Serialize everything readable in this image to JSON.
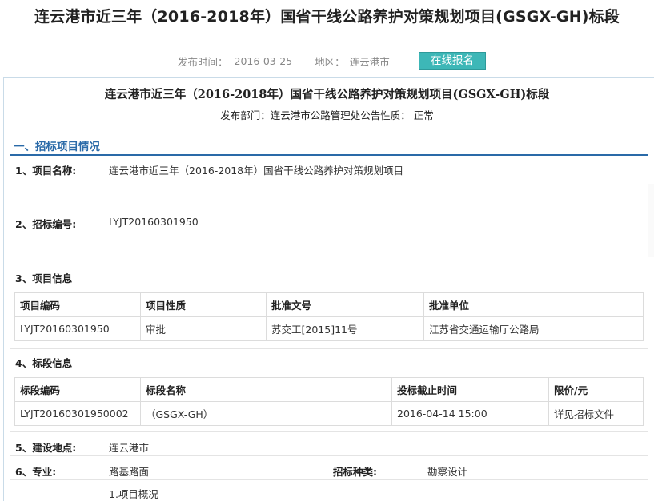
{
  "header": {
    "title": "连云港市近三年（2016-2018年）国省干线公路养护对策规划项目(GSGX-GH)标段",
    "publish_time_label": "发布时间：",
    "publish_time": "2016-03-25",
    "region_label": "地区：",
    "region": "连云港市",
    "signup_button": "在线报名"
  },
  "doc": {
    "title": "连云港市近三年（2016-2018年）国省干线公路养护对策规划项目(GSGX-GH)标段",
    "publisher_line": "发布部门：连云港市公路管理处公告性质：  正常"
  },
  "section1": {
    "heading": "一、招标项目情况",
    "item1_label": "1、项目名称:",
    "item1_value": "连云港市近三年（2016-2018年）国省干线公路养护对策规划项目",
    "item2_label": "2、招标编号:",
    "item2_value": "LYJT20160301950",
    "item3_label": "3、项目信息",
    "item4_label": "4、标段信息",
    "item5_label": "5、建设地点:",
    "item5_value": "连云港市",
    "item6_label": "6、专业:",
    "item6_value": "路基路面",
    "type_label": "招标种类:",
    "type_value": "勘察设计",
    "overview": "1.项目概况"
  },
  "project_table": {
    "headers": [
      "项目编码",
      "项目性质",
      "批准文号",
      "批准单位"
    ],
    "rows": [
      [
        "LYJT20160301950",
        "审批",
        "苏交工[2015]11号",
        "江苏省交通运输厅公路局"
      ]
    ]
  },
  "section_table": {
    "headers": [
      "标段编码",
      "标段名称",
      "投标截止时间",
      "限价/元"
    ],
    "rows": [
      [
        "LYJT20160301950002",
        "（GSGX-GH）",
        "2016-04-14 15:00",
        "详见招标文件"
      ]
    ]
  }
}
